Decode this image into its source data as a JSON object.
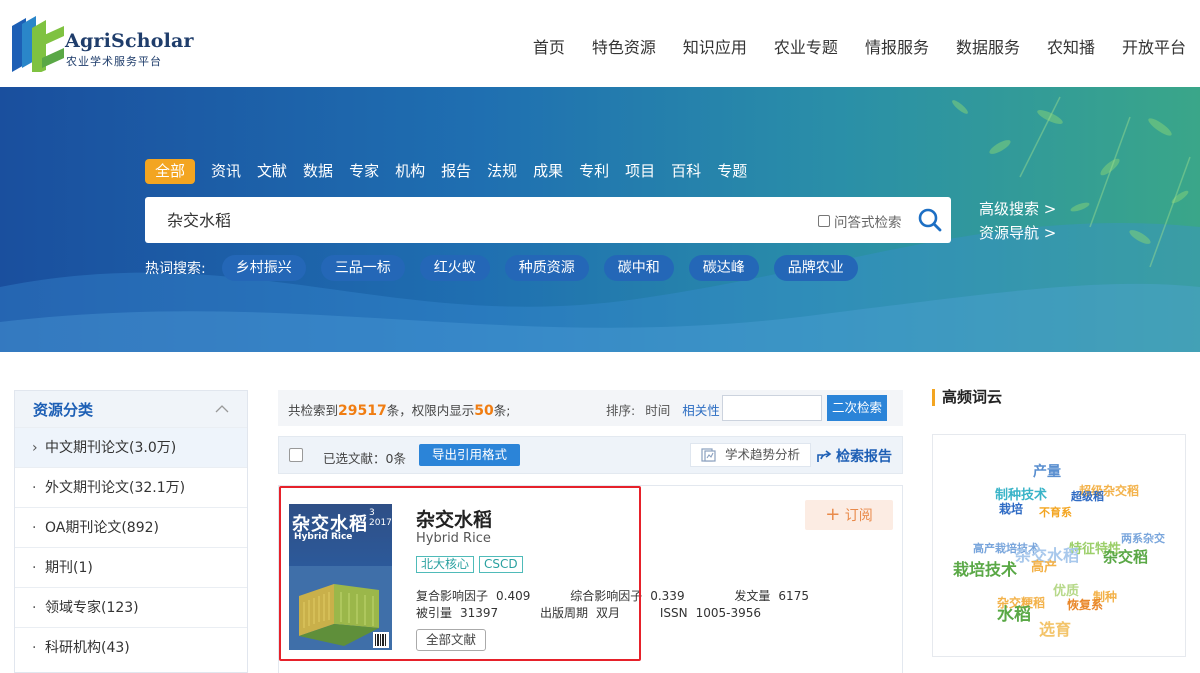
{
  "logo": {
    "title": "AgriScholar",
    "subtitle": "农业学术服务平台"
  },
  "topnav": [
    "首页",
    "特色资源",
    "知识应用",
    "农业专题",
    "情报服务",
    "数据服务",
    "农知播",
    "开放平台"
  ],
  "search": {
    "categories": [
      "全部",
      "资讯",
      "文献",
      "数据",
      "专家",
      "机构",
      "报告",
      "法规",
      "成果",
      "专利",
      "项目",
      "百科",
      "专题"
    ],
    "active_category": "全部",
    "query": "杂交水稻",
    "qa_label": "问答式检索",
    "advanced": "高级搜索 >",
    "navigation": "资源导航 >",
    "hot_label": "热词搜索:",
    "hot_tags": [
      "乡村振兴",
      "三品一标",
      "红火蚁",
      "种质资源",
      "碳中和",
      "碳达峰",
      "品牌农业"
    ]
  },
  "sidebar": {
    "title": "资源分类",
    "items": [
      "中文期刊论文(3.0万)",
      "外文期刊论文(32.1万)",
      "OA期刊论文(892)",
      "期刊(1)",
      "领域专家(123)",
      "科研机构(43)"
    ]
  },
  "results": {
    "prefix": "共检索到",
    "total": "29517",
    "mid": "条，权限内显示",
    "shown": "50",
    "suffix": "条;",
    "sort_label": "排序:",
    "sort_time": "时间",
    "sort_relevance": "相关性",
    "second_search": "二次检索",
    "selected": "已选文献：0条",
    "export": "导出引用格式",
    "trend": "学术趋势分析",
    "report": "检索报告"
  },
  "journal": {
    "cover_title": "杂交水稻",
    "cover_sub": "Hybrid Rice",
    "cover_issue": "3",
    "cover_year": "2017",
    "title": "杂交水稻",
    "en_title": "Hybrid Rice",
    "tags": [
      "北大核心",
      "CSCD"
    ],
    "impact_label": "复合影响因子",
    "impact": "0.409",
    "composite_label": "综合影响因子",
    "composite": "0.339",
    "volume_label": "发文量",
    "volume": "6175",
    "cited_label": "被引量",
    "cited": "31397",
    "cycle_label": "出版周期",
    "cycle": "双月",
    "issn_label": "ISSN",
    "issn": "1005-3956",
    "all_docs": "全部文献",
    "subscribe": "订阅"
  },
  "cloud": {
    "title": "高频词云",
    "words": [
      {
        "text": "产量",
        "color": "#5a8fd0"
      },
      {
        "text": "制种技术",
        "color": "#3ab4c8"
      },
      {
        "text": "超级杂交稻",
        "color": "#f3b24a"
      },
      {
        "text": "超级稻",
        "color": "#2f6bc4"
      },
      {
        "text": "栽培",
        "color": "#2f6bc4"
      },
      {
        "text": "不育系",
        "color": "#f3a521"
      },
      {
        "text": "两系杂交",
        "color": "#7aa6dc"
      },
      {
        "text": "特征特性",
        "color": "#9ccf6a"
      },
      {
        "text": "高产栽培技术",
        "color": "#7aa6dc"
      },
      {
        "text": "杂交水稻",
        "color": "#a8c8ec"
      },
      {
        "text": "杂交稻",
        "color": "#5aa846"
      },
      {
        "text": "栽培技术",
        "color": "#5aa846"
      },
      {
        "text": "高产",
        "color": "#f3b24a"
      },
      {
        "text": "优质",
        "color": "#b7d98a"
      },
      {
        "text": "制种",
        "color": "#f3b24a"
      },
      {
        "text": "杂交粳稻",
        "color": "#f3b24a"
      },
      {
        "text": "恢复系",
        "color": "#e9882c"
      },
      {
        "text": "水稻",
        "color": "#5aa846"
      },
      {
        "text": "选育",
        "color": "#f3c46a"
      }
    ]
  },
  "colors": {
    "brand_blue": "#1d5fb5",
    "accent_orange": "#f3a521",
    "highlight_red": "#e6212a"
  }
}
